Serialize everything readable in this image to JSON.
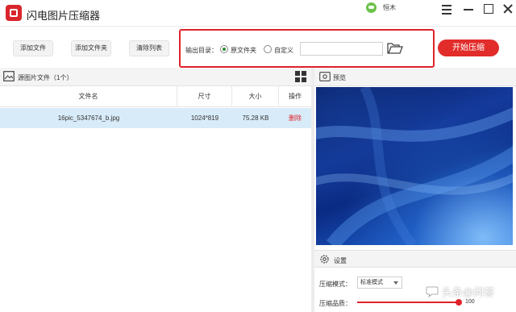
{
  "app": {
    "title": "闪电图片压缩器"
  },
  "user": {
    "name": "恒木"
  },
  "toolbar": {
    "add_file": "添加文件",
    "add_folder": "添加文件夹",
    "clear_list": "清除列表",
    "output_label": "输出目录：",
    "radio_original": "原文件夹",
    "radio_custom": "自定义",
    "output_selected": "原文件夹",
    "path_value": "",
    "start_button": "开始压缩"
  },
  "file_list": {
    "title": "源图片文件（1个）",
    "columns": [
      "文件名",
      "尺寸",
      "大小",
      "操作"
    ],
    "rows": [
      {
        "name": "16pic_5347674_b.jpg",
        "size": "1024*819",
        "filesize": "75.28 KB",
        "action": "删除"
      }
    ]
  },
  "preview": {
    "title": "预览"
  },
  "settings": {
    "title": "设置",
    "mode_label": "压缩模式：",
    "mode_value": "标准模式",
    "quality_label": "压缩品质：",
    "quality_value": "100",
    "quality_fraction": 1.0
  },
  "watermark": {
    "text": "头条@问答"
  },
  "colors": {
    "accent": "#e22c2a",
    "selected_row": "#d8ebf8"
  },
  "icons": [
    "app-logo-icon",
    "wechat-avatar-icon",
    "menu-icon",
    "minimize-icon",
    "maximize-icon",
    "close-icon",
    "folder-open-icon",
    "image-icon",
    "grid-view-icon",
    "eye-icon",
    "gear-icon"
  ]
}
